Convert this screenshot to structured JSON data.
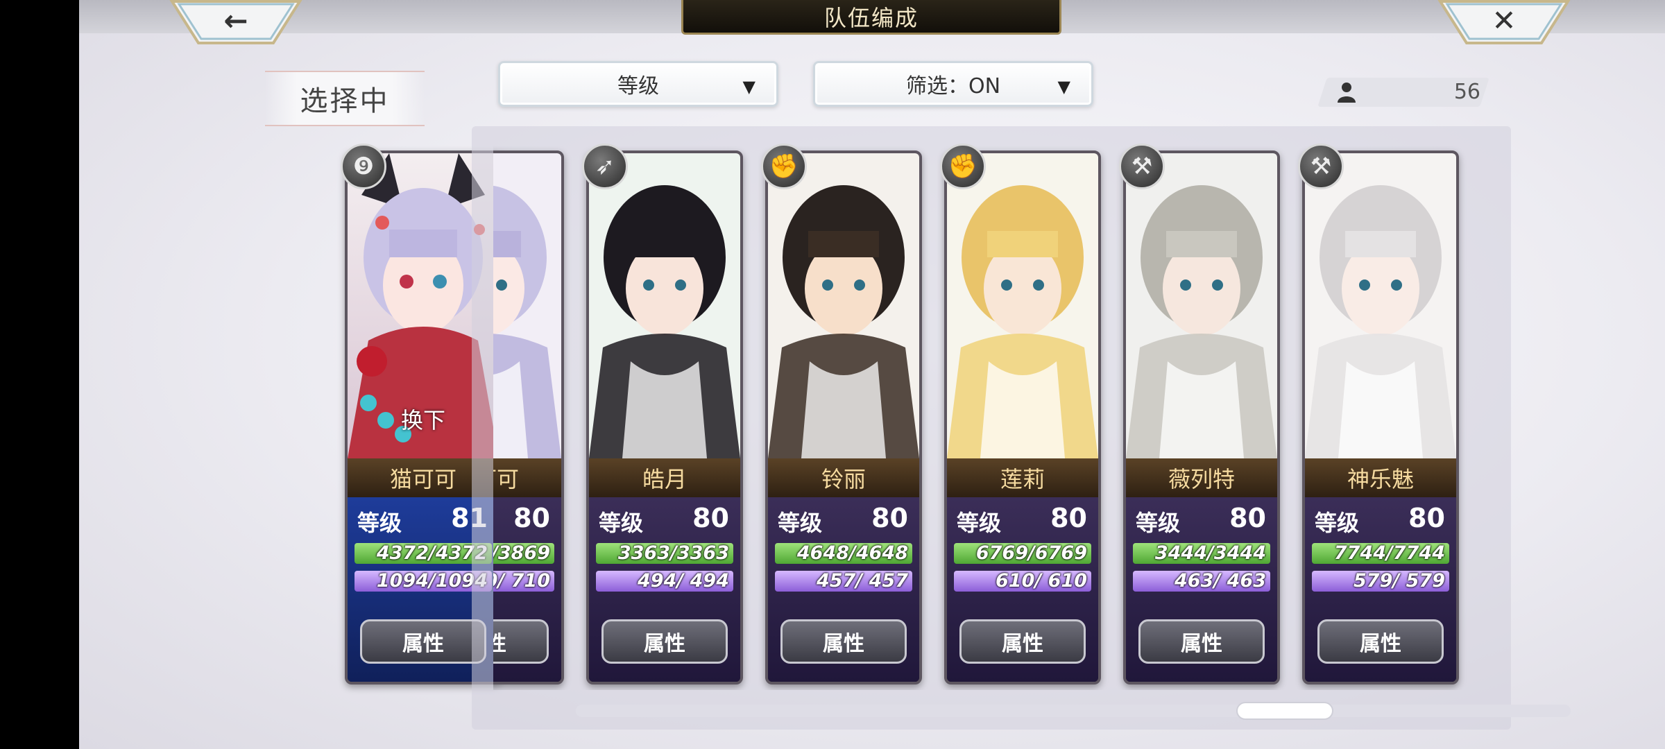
{
  "header": {
    "title": "队伍编成",
    "back_icon": "back-arrow-icon",
    "back_glyph": "←",
    "close_icon": "close-icon",
    "close_glyph": "✕"
  },
  "selecting_label": "选择中",
  "sort_dropdown": {
    "value": "等级",
    "arrow": "▼"
  },
  "filter_dropdown": {
    "value": "筛选：ON",
    "arrow": "▼"
  },
  "unit_count": {
    "icon": "person-icon",
    "value": "56"
  },
  "selected": {
    "name": "猫可可",
    "level_label": "等级",
    "level": "81",
    "hp": "4372/4372",
    "mp": "1094/1094",
    "swap_label": "换下",
    "attr_label": "属性",
    "type_icon": "staff-icon",
    "type_glyph": "❾"
  },
  "roster": [
    {
      "name": "猫可可",
      "level_label": "级",
      "level": "80",
      "hp": "69/3869",
      "mp": "0/ 710",
      "attr_label": "属性",
      "type_icon": "",
      "type_glyph": ""
    },
    {
      "name": "皓月",
      "level_label": "等级",
      "level": "80",
      "hp": "3363/3363",
      "mp": "494/ 494",
      "attr_label": "属性",
      "type_icon": "bow-icon",
      "type_glyph": "➶"
    },
    {
      "name": "铃丽",
      "level_label": "等级",
      "level": "80",
      "hp": "4648/4648",
      "mp": "457/ 457",
      "attr_label": "属性",
      "type_icon": "fist-icon",
      "type_glyph": "✊"
    },
    {
      "name": "莲莉",
      "level_label": "等级",
      "level": "80",
      "hp": "6769/6769",
      "mp": "610/ 610",
      "attr_label": "属性",
      "type_icon": "fist-icon",
      "type_glyph": "✊"
    },
    {
      "name": "薇列特",
      "level_label": "等级",
      "level": "80",
      "hp": "3444/3444",
      "mp": "463/ 463",
      "attr_label": "属性",
      "type_icon": "hammer-icon",
      "type_glyph": "⚒"
    },
    {
      "name": "神乐魅",
      "level_label": "等级",
      "level": "80",
      "hp": "7744/7744",
      "mp": "579/ 579",
      "attr_label": "属性",
      "type_icon": "hammer-icon",
      "type_glyph": "⚒"
    }
  ],
  "colors": {
    "accent_gold": "#9b8552",
    "hp_green": "#4fa734",
    "mp_purple": "#8c5ed8",
    "stats_panel": "#2b2247",
    "selected_panel": "#1e3c9a"
  }
}
